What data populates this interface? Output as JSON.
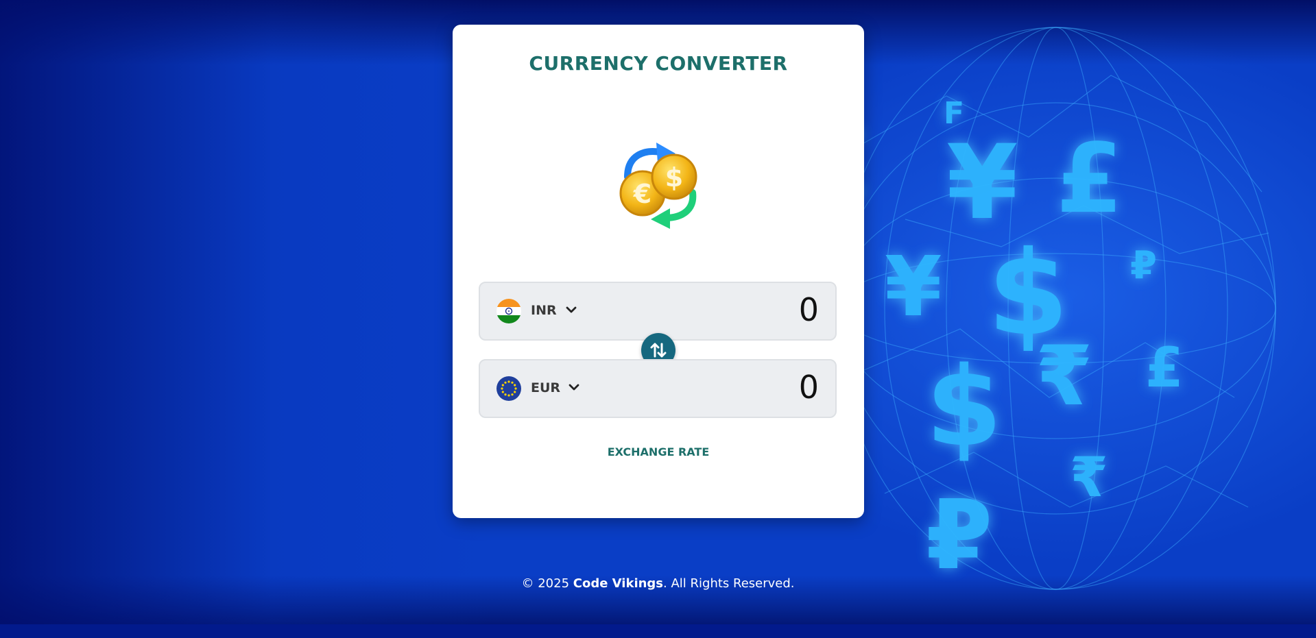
{
  "app": {
    "title": "CURRENCY CONVERTER",
    "logo_icon": "currency-exchange-coins-icon"
  },
  "from": {
    "currency": "INR",
    "flag_icon": "india-flag-icon",
    "amount": "0"
  },
  "to": {
    "currency": "EUR",
    "flag_icon": "eu-flag-icon",
    "amount": "0"
  },
  "swap_icon": "swap-arrows-icon",
  "exchange_rate_label": "EXCHANGE RATE",
  "footer": {
    "prefix": "© 2025 ",
    "brand": "Code Vikings",
    "suffix": ". All Rights Reserved."
  },
  "colors": {
    "title": "#1d6f6a",
    "swap_button": "#16687f",
    "background": "#0a3fc8",
    "card": "#ffffff"
  }
}
